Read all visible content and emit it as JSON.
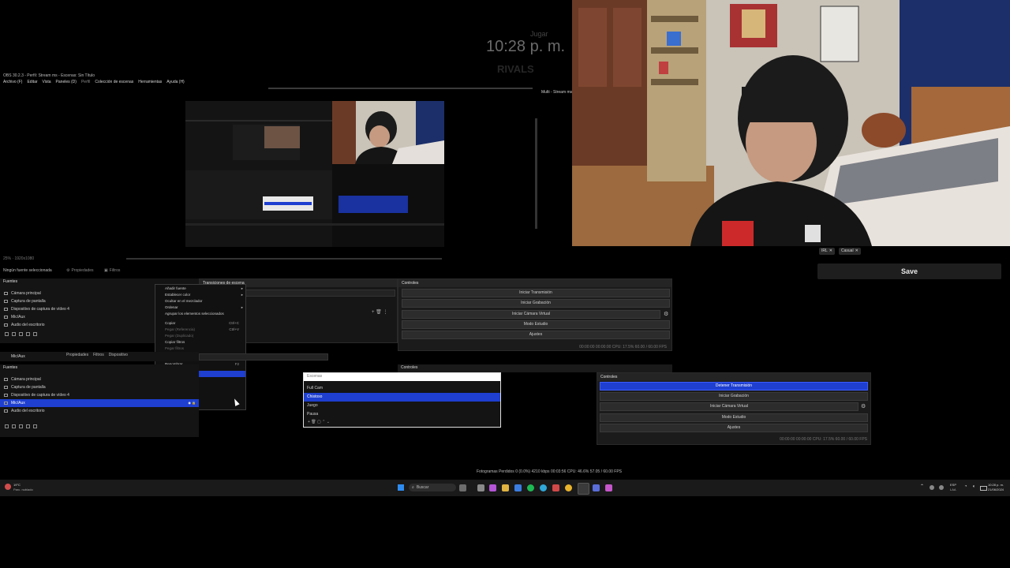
{
  "overlay": {
    "clock": "10:28 p. m.",
    "top_faded": "Jugar",
    "rivals_faded": "RIVALS"
  },
  "obs": {
    "title": "OBS 30.2.3 - Perfil: Stream ms - Escenas: Sin Título",
    "menu": [
      "Archivo (F)",
      "Editar",
      "Vista",
      "Paneles (D)",
      "Perfil",
      "Colección de escenas",
      "Herramientas",
      "Ayuda (H)"
    ],
    "side_label": "Multi - Stream ms"
  },
  "preview_scale": "25% · 1920x1080",
  "status_left": "Ningún fuente seleccionada",
  "tabs_top": [
    "Propiedades",
    "Filtros"
  ],
  "panels": {
    "fuentes": "Fuentes",
    "transiciones": "Transiciones de escena",
    "controles": "Controles"
  },
  "sources_top": [
    "Cámara principal",
    "Captura de pantalla",
    "Dispositivo de captura de vídeo 4",
    "Mic/Aux",
    "Audio del escritorio"
  ],
  "context_menu": {
    "items": [
      {
        "label": "Añadir fuente",
        "shortcut": "",
        "arrow": true,
        "dim": false
      },
      {
        "label": "Establecer color",
        "shortcut": "",
        "arrow": true,
        "dim": false
      },
      {
        "label": "Ocultar en el mezclador",
        "shortcut": "",
        "arrow": false,
        "dim": false
      },
      {
        "label": "Ordenar",
        "shortcut": "",
        "arrow": true,
        "dim": false
      },
      {
        "label": "Agrupar los elementos seleccionados",
        "shortcut": "",
        "arrow": false,
        "dim": false
      },
      {
        "label": "Copiar",
        "shortcut": "Ctrl+C",
        "arrow": false,
        "dim": false
      },
      {
        "label": "Pegar (Referencia)",
        "shortcut": "Ctrl+V",
        "arrow": false,
        "dim": true
      },
      {
        "label": "Pegar (Duplicado)",
        "shortcut": "",
        "arrow": false,
        "dim": true
      },
      {
        "label": "Copiar filtros",
        "shortcut": "",
        "arrow": false,
        "dim": false
      },
      {
        "label": "Pegar filtros",
        "shortcut": "",
        "arrow": false,
        "dim": true
      },
      {
        "label": "Eliminar",
        "shortcut": "Del",
        "arrow": false,
        "dim": false
      },
      {
        "label": "Renombrar",
        "shortcut": "F2",
        "arrow": false,
        "dim": false
      },
      {
        "label": "Filtros",
        "shortcut": "",
        "arrow": false,
        "dim": false,
        "selected": true
      },
      {
        "label": "Propiedades",
        "shortcut": "",
        "arrow": false,
        "dim": false
      }
    ]
  },
  "controls_top": [
    "Iniciar Transmisión",
    "Iniciar Grabación",
    "Iniciar Cámara Virtual",
    "Modo Estudio",
    "Ajustes"
  ],
  "stats_top": "00:00:00  00:00:00  CPU: 17.5%  60.00 / 60.00 FPS",
  "mid_mic_label": "Mic/Aux",
  "tabs_mid": [
    "Propiedades",
    "Filtros",
    "Dispositivo"
  ],
  "sources_mid": [
    "Cámara principal",
    "Captura de pantalla",
    "Dispositivo de captura de vídeo 4",
    "Mic/Aux",
    "Audio del escritorio"
  ],
  "scene_list": {
    "header": "Escenas",
    "items": [
      "Full Cam",
      "Chistoso",
      "Juego",
      "Pausa"
    ],
    "selected": 1
  },
  "controls_mid_title": "Controles",
  "controls_right": {
    "title": "Controles",
    "buttons": [
      "Detener Transmisión",
      "Iniciar Grabación",
      "Iniciar Cámara Virtual",
      "Modo Estudio",
      "Ajustes"
    ],
    "stats": "00:00:00  00:00:00  CPU: 17.5%  60.00 / 60.00 FPS"
  },
  "tags": [
    "IRL",
    "Casual"
  ],
  "save_label": "Save",
  "status_bar": "Fotogramas Perdidos 0 (0.0%)  4210 kbps  00:03:56  CPU: 46.6%  57.05 / 60.00 FPS",
  "taskbar": {
    "search": "Buscar",
    "weather_top": "19°C",
    "weather_bottom": "Parc. nublado",
    "lang_top": "ESP",
    "lang_bottom": "LAA",
    "time": "10:28 p. m.",
    "date": "21/06/2024"
  },
  "colors": {
    "accent": "#1e3fd0",
    "panel": "#1b1b1b"
  }
}
